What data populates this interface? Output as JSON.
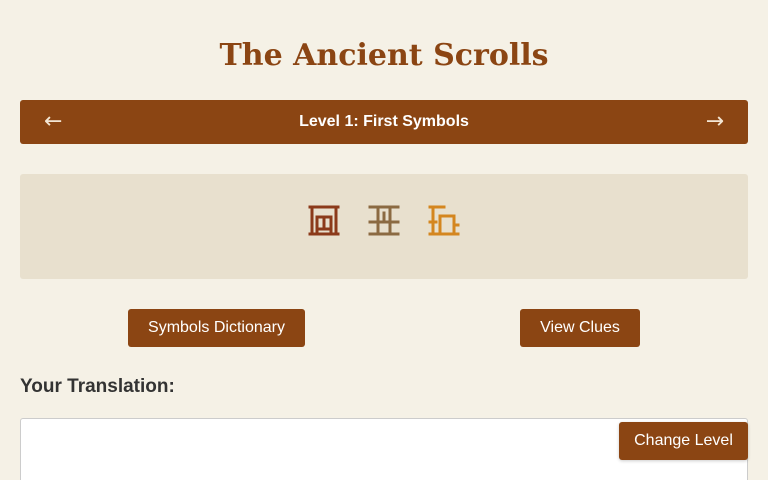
{
  "title": "The Ancient Scrolls",
  "level_nav": {
    "prev_icon": "←",
    "next_icon": "→",
    "level_title": "Level 1: First Symbols"
  },
  "symbols": [
    {
      "icon": "glyph-1-icon",
      "color": "#8b3a1a"
    },
    {
      "icon": "glyph-2-icon",
      "color": "#8b6a42"
    },
    {
      "icon": "glyph-3-icon",
      "color": "#d4861f"
    }
  ],
  "buttons": {
    "dictionary": "Symbols Dictionary",
    "clues": "View Clues",
    "change_level": "Change Level"
  },
  "translation": {
    "label": "Your Translation:",
    "value": "",
    "placeholder": ""
  },
  "colors": {
    "background": "#f5f1e6",
    "accent": "#8b4513",
    "panel": "#e8e0ce"
  }
}
